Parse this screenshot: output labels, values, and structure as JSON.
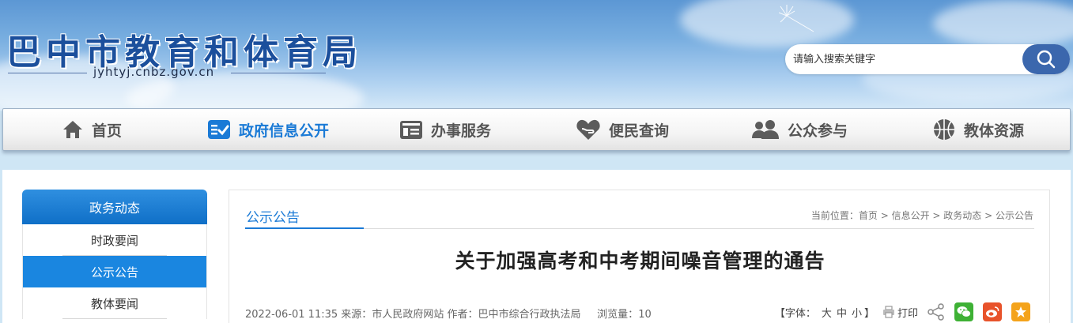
{
  "site": {
    "title": "巴中市教育和体育局",
    "url": "jyhtyj.cnbz.gov.cn"
  },
  "search": {
    "placeholder": "请输入搜索关键字"
  },
  "nav": {
    "items": [
      {
        "label": "首页",
        "icon": "home-icon"
      },
      {
        "label": "政府信息公开",
        "icon": "info-disclosure-icon",
        "active": true
      },
      {
        "label": "办事服务",
        "icon": "service-icon"
      },
      {
        "label": "便民查询",
        "icon": "heart-hand-icon"
      },
      {
        "label": "公众参与",
        "icon": "people-icon"
      },
      {
        "label": "教体资源",
        "icon": "basketball-icon"
      }
    ]
  },
  "sidebar": {
    "heading": "政务动态",
    "items": [
      {
        "label": "时政要闻"
      },
      {
        "label": "公示公告",
        "active": true
      },
      {
        "label": "教体要闻"
      }
    ]
  },
  "main": {
    "tab_title": "公示公告",
    "breadcrumb": {
      "prefix": "当前位置：",
      "items": [
        "首页",
        "信息公开",
        "政务动态",
        "公示公告"
      ],
      "separator": " > "
    },
    "article_title": "关于加强高考和中考期间噪音管理的通告",
    "meta": {
      "date": "2022-06-01 11:35",
      "source_label": "来源：",
      "source": "市人民政府网站",
      "author_label": "作者：",
      "author": "巴中市综合行政执法局",
      "views_label": "浏览量：",
      "views": "10"
    },
    "tools": {
      "font_label": "【字体：",
      "font_large": "大",
      "font_medium": "中",
      "font_small": "小",
      "font_close": "】",
      "print_label": "打印"
    }
  },
  "colors": {
    "brand_blue": "#1a7ad6",
    "title_blue": "#1b4f9c",
    "search_button": "#3b67ad",
    "wechat": "#3eb135",
    "weibo": "#e8532b",
    "favorite": "#f4a31b"
  }
}
